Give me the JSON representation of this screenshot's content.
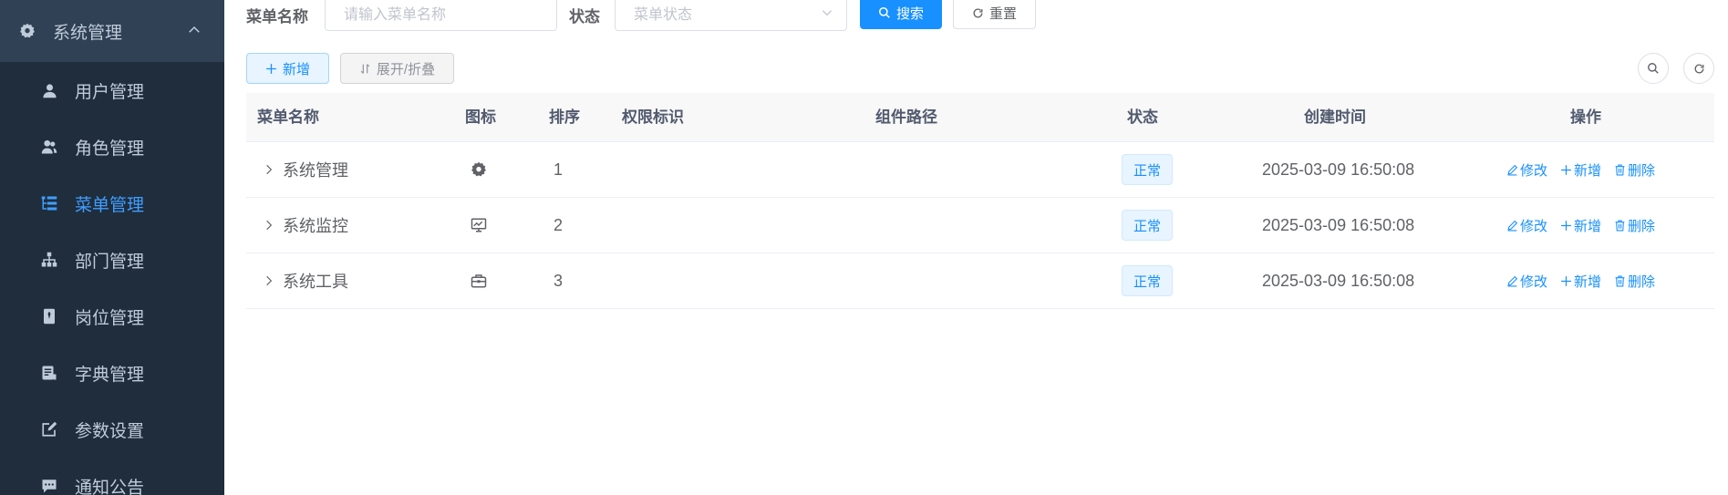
{
  "sidebar": {
    "group": {
      "label": "系统管理",
      "icon": "gear-icon"
    },
    "items": [
      {
        "label": "用户管理",
        "icon": "user-icon",
        "active": false
      },
      {
        "label": "角色管理",
        "icon": "peoples-icon",
        "active": false
      },
      {
        "label": "菜单管理",
        "icon": "tree-table-icon",
        "active": true
      },
      {
        "label": "部门管理",
        "icon": "tree-icon",
        "active": false
      },
      {
        "label": "岗位管理",
        "icon": "post-icon",
        "active": false
      },
      {
        "label": "字典管理",
        "icon": "dict-icon",
        "active": false
      },
      {
        "label": "参数设置",
        "icon": "edit-icon",
        "active": false
      },
      {
        "label": "通知公告",
        "icon": "message-icon",
        "active": false
      }
    ]
  },
  "search": {
    "name_label": "菜单名称",
    "name_placeholder": "请输入菜单名称",
    "status_label": "状态",
    "status_placeholder": "菜单状态",
    "search_button": "搜索",
    "reset_button": "重置"
  },
  "toolbar": {
    "add_button": "新增",
    "toggle_button": "展开/折叠"
  },
  "table": {
    "columns": [
      "菜单名称",
      "图标",
      "排序",
      "权限标识",
      "组件路径",
      "状态",
      "创建时间",
      "操作"
    ],
    "rows": [
      {
        "name": "系统管理",
        "icon": "gear-icon",
        "order": "1",
        "perms": "",
        "component": "",
        "status": "正常",
        "created": "2025-03-09 16:50:08"
      },
      {
        "name": "系统监控",
        "icon": "monitor-icon",
        "order": "2",
        "perms": "",
        "component": "",
        "status": "正常",
        "created": "2025-03-09 16:50:08"
      },
      {
        "name": "系统工具",
        "icon": "toolbox-icon",
        "order": "3",
        "perms": "",
        "component": "",
        "status": "正常",
        "created": "2025-03-09 16:50:08"
      }
    ],
    "actions": {
      "edit": "修改",
      "add": "新增",
      "delete": "删除"
    }
  },
  "colors": {
    "sidebar_bg": "#304156",
    "submenu_bg": "#1f2d3d",
    "accent": "#1890ff",
    "active_menu": "#409eff"
  }
}
